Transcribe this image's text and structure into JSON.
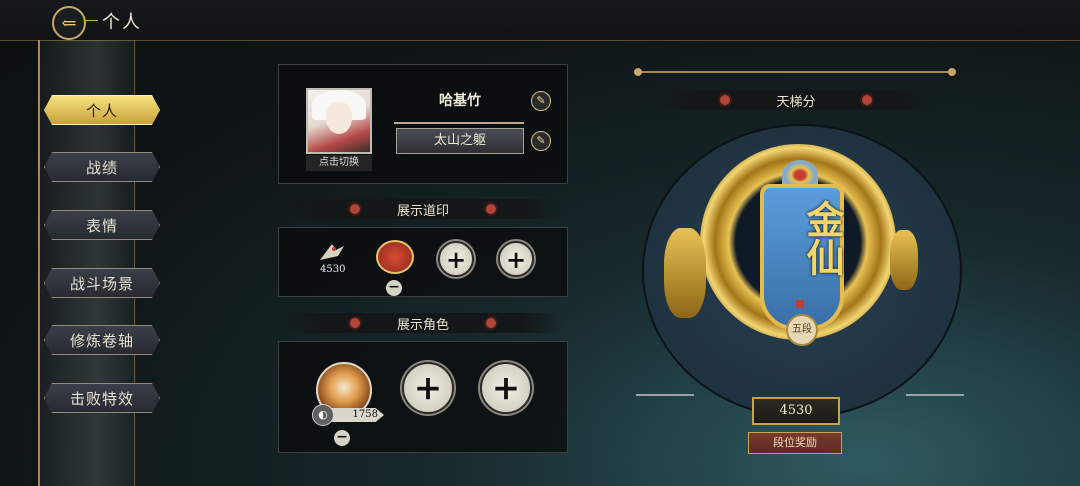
{
  "header": {
    "back_icon": "back-arrow-icon",
    "title": "个人"
  },
  "sidebar": {
    "items": [
      {
        "label": "个人",
        "active": true
      },
      {
        "label": "战绩",
        "active": false
      },
      {
        "label": "表情",
        "active": false
      },
      {
        "label": "战斗场景",
        "active": false
      },
      {
        "label": "修炼卷轴",
        "active": false
      },
      {
        "label": "击败特效",
        "active": false
      }
    ]
  },
  "profile": {
    "tap_to_switch": "点击切换",
    "player_name": "哈基竹",
    "player_title": "太山之躯"
  },
  "seal_section": {
    "title": "展示道印",
    "item1_count": "4530"
  },
  "character_section": {
    "title": "展示角色",
    "tiger_level": "1758"
  },
  "ladder": {
    "title": "天梯分",
    "rank_name": "金仙",
    "tier": "五段",
    "score": "4530",
    "reward_button": "段位奖励"
  },
  "colors": {
    "accent_gold": "#c9a865",
    "active_tab": "#f2d774",
    "panel_bg": "#0a0c0d"
  }
}
